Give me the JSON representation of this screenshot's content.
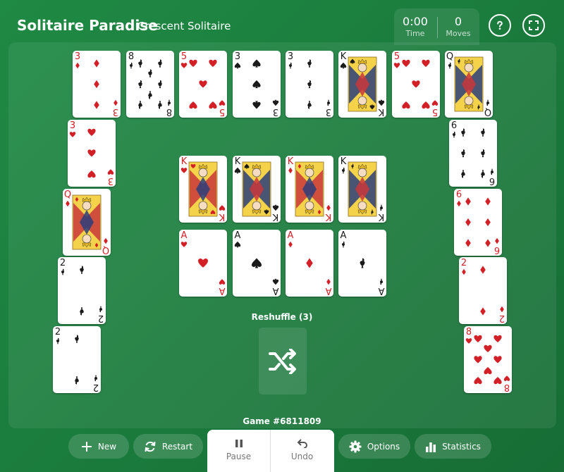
{
  "header": {
    "app_title": "Solitaire Paradise",
    "variant": "Crescent Solitaire",
    "time_value": "0:00",
    "time_label": "Time",
    "moves_value": "0",
    "moves_label": "Moves"
  },
  "board": {
    "reshuffle_label": "Reshuffle (3)",
    "game_number": "Game #6811809"
  },
  "cards": {
    "top_row": [
      {
        "rank": "3",
        "suit": "diamonds"
      },
      {
        "rank": "8",
        "suit": "clubs"
      },
      {
        "rank": "5",
        "suit": "hearts"
      },
      {
        "rank": "3",
        "suit": "spades"
      },
      {
        "rank": "3",
        "suit": "clubs"
      },
      {
        "rank": "K",
        "suit": "spades"
      },
      {
        "rank": "5",
        "suit": "hearts"
      },
      {
        "rank": "Q",
        "suit": "clubs"
      }
    ],
    "left_column": [
      {
        "rank": "3",
        "suit": "hearts"
      },
      {
        "rank": "Q",
        "suit": "diamonds"
      },
      {
        "rank": "2",
        "suit": "clubs"
      },
      {
        "rank": "2",
        "suit": "clubs"
      }
    ],
    "right_column": [
      {
        "rank": "6",
        "suit": "clubs"
      },
      {
        "rank": "6",
        "suit": "diamonds"
      },
      {
        "rank": "2",
        "suit": "diamonds"
      },
      {
        "rank": "8",
        "suit": "hearts"
      }
    ],
    "foundation_kings": [
      {
        "rank": "K",
        "suit": "hearts"
      },
      {
        "rank": "K",
        "suit": "spades"
      },
      {
        "rank": "K",
        "suit": "diamonds"
      },
      {
        "rank": "K",
        "suit": "clubs"
      }
    ],
    "foundation_aces": [
      {
        "rank": "A",
        "suit": "hearts"
      },
      {
        "rank": "A",
        "suit": "spades"
      },
      {
        "rank": "A",
        "suit": "diamonds"
      },
      {
        "rank": "A",
        "suit": "clubs"
      }
    ]
  },
  "toolbar": {
    "new_label": "New",
    "restart_label": "Restart",
    "pause_label": "Pause",
    "undo_label": "Undo",
    "options_label": "Options",
    "statistics_label": "Statistics"
  },
  "icons": {
    "help": "help-icon",
    "fullscreen": "fullscreen-icon",
    "shuffle": "shuffle-icon",
    "plus": "plus-icon",
    "restart": "restart-icon",
    "pause": "pause-icon",
    "undo": "undo-icon",
    "gear": "gear-icon",
    "bar_chart": "bar-chart-icon"
  },
  "colors": {
    "red_suit": "#d31f26",
    "black_suit": "#1a1a1a",
    "background": "#1a7a3c"
  }
}
